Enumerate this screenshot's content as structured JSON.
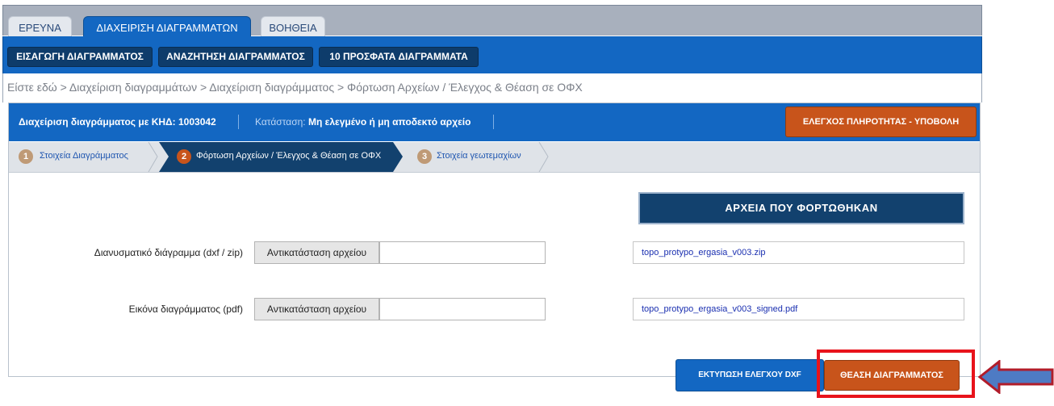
{
  "top_tabs": [
    "ΕΡΕΥΝΑ",
    "ΔΙΑΧΕΙΡΙΣΗ ΔΙΑΓΡΑΜΜΑΤΩΝ",
    "ΒΟΗΘΕΙΑ"
  ],
  "top_tabs_active": 1,
  "nav": {
    "import": "ΕΙΣΑΓΩΓΗ ΔΙΑΓΡΑΜΜΑΤΟΣ",
    "search": "ΑΝΑΖΗΤΗΣΗ ΔΙΑΓΡΑΜΜΑΤΟΣ",
    "recent": "10 ΠΡΟΣΦΑΤΑ ΔΙΑΓΡΑΜΜΑΤΑ"
  },
  "breadcrumb": "Είστε εδώ > Διαχείριση διαγραμμάτων > Διαχείριση διαγράμματος > Φόρτωση Αρχείων / Έλεγχος & Θέαση σε ΟΦΧ",
  "info": {
    "management": "Διαχείριση διαγράμματος με ΚΗΔ: 1003042",
    "status_label": "Κατάσταση:",
    "status_value": "Μη ελεγμένο ή μη αποδεκτό αρχείο",
    "submit_button": "ΕΛΕΓΧΟΣ ΠΛΗΡΟΤΗΤΑΣ - ΥΠΟΒΟΛΗ"
  },
  "steps": [
    {
      "num": "1",
      "label": "Στοιχεία Διαγράμματος"
    },
    {
      "num": "2",
      "label": "Φόρτωση Αρχείων / Έλεγχος & Θέαση σε ΟΦΧ"
    },
    {
      "num": "3",
      "label": "Στοιχεία γεωτεμαχίων"
    }
  ],
  "steps_active": 1,
  "form": {
    "vector_label": "Διανυσματικό διάγραμμα (dxf / zip)",
    "image_label": "Εικόνα διαγράμματος (pdf)",
    "replace_button": "Αντικατάσταση αρχείου",
    "vector_value": "",
    "image_value": ""
  },
  "uploaded": {
    "header": "ΑΡΧΕΙΑ ΠΟΥ ΦΟΡΤΩΘΗΚΑΝ",
    "files": [
      "topo_protypo_ergasia_v003.zip",
      "topo_protypo_ergasia_v003_signed.pdf"
    ]
  },
  "actions": {
    "print_dxf": "ΕΚΤΥΠΩΣΗ ΕΛΕΓΧΟΥ DXF",
    "view_diagram": "ΘΕΑΣΗ ΔΙΑΓΡΑΜΜΑΤΟΣ"
  },
  "colors": {
    "brand_blue": "#1367c2",
    "dark_navy": "#12416e",
    "accent_orange": "#c8541b",
    "highlight_red": "#e8131b"
  }
}
